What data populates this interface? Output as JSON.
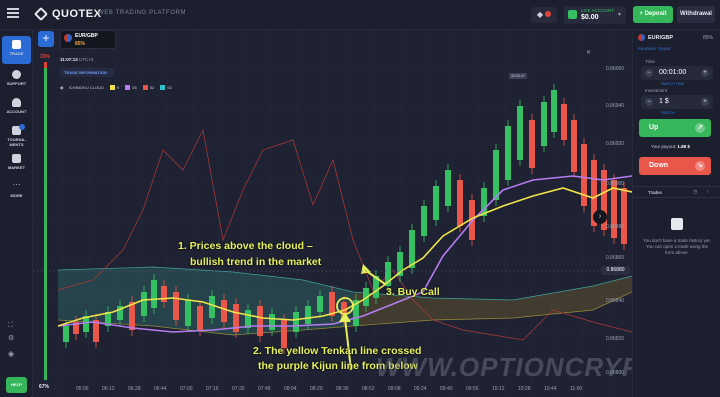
{
  "header": {
    "logo": "QUOTEX",
    "platform": "WEB TRADING PLATFORM",
    "balance_label": "LIVE ACCOUNT",
    "balance": "$0.00",
    "deposit": "Deposit",
    "withdrawal": "Withdrawal"
  },
  "nav": {
    "items": [
      {
        "label": "TRADE"
      },
      {
        "label": "SUPPORT"
      },
      {
        "label": "ACCOUNT"
      },
      {
        "label": "TOURNA-MENTS"
      },
      {
        "label": "MARKET"
      },
      {
        "label": "MORE"
      }
    ],
    "help": "HELP"
  },
  "chart_tab": {
    "pair": "EUR/GBP",
    "payout": "85%"
  },
  "chart": {
    "time_row": "11:07:13",
    "time_suffix": "UTC+3",
    "info_pill": "TRADE INFORMATION",
    "indicator_name": "ICHIMOKU CLOUD",
    "indicator_params": [
      "9",
      "26",
      "52",
      "52"
    ],
    "side_pct_top": "33%",
    "side_pct_bottom": "67%",
    "current_price": "0.86880",
    "price_axis": [
      "0.86960",
      "0.86940",
      "0.86920",
      "0.86900",
      "0.86880",
      "0.86860",
      "0.86840",
      "0.86820",
      "0.86800"
    ],
    "time_axis": [
      "05:56",
      "06:12",
      "06:28",
      "06:44",
      "07:00",
      "07:16",
      "07:32",
      "07:48",
      "08:04",
      "08:20",
      "08:36",
      "08:52",
      "09:08",
      "09:24",
      "09:40",
      "09:56",
      "10:12",
      "10:28",
      "10:44",
      "11:00"
    ],
    "timer": "00:00:47"
  },
  "annotations": {
    "a1_line1": "1. Prices above the cloud –",
    "a1_line2": "bullish trend in the market",
    "a2_line1": "2. The yellow Tenkan line crossed",
    "a2_line2": "the purple Kijun line from below",
    "a3": "3. Buy Call"
  },
  "watermark": "WWW.OPTIONCRYPTO.COM",
  "right_panel": {
    "pair": "EUR/GBP",
    "pct": "85%",
    "pending": "PENDING TRADE",
    "time_label": "Time",
    "time_value": "00:01:00",
    "switch_time": "SWITCH TIME",
    "investment_label": "Investment",
    "investment_value": "1 $",
    "switch_pct": "SWITCH",
    "up": "Up",
    "payout_label": "Your payout:",
    "payout_value": "1.88 $",
    "down": "Down",
    "trades": "Trades",
    "empty": "You don't have a trade history yet. You can open a trade using the form above."
  },
  "colors": {
    "tenkan": "#f0e44a",
    "kijun": "#b57cf0",
    "up_candle": "#35c163",
    "down_candle": "#e9574a",
    "cloud_bull": "#2e6d68",
    "cloud_bear": "#6b5d2a"
  }
}
